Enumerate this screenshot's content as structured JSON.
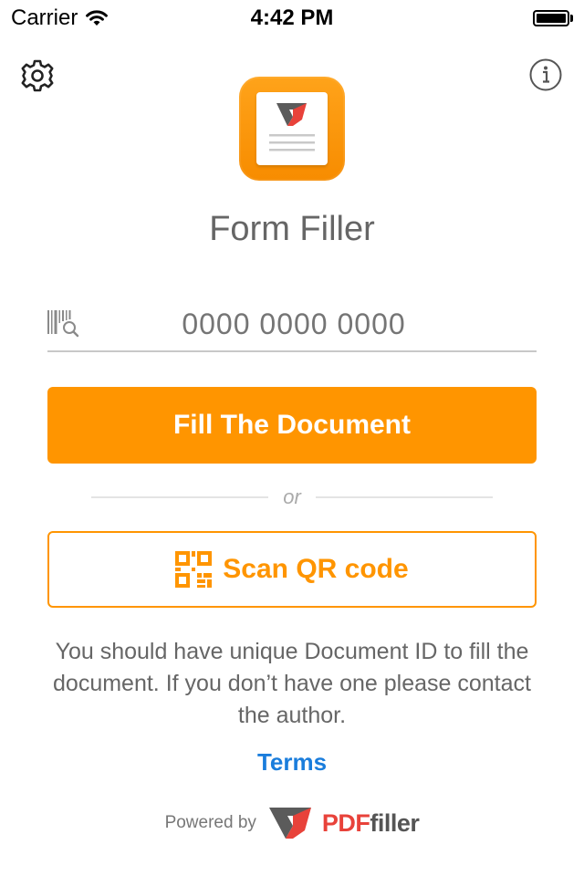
{
  "status_bar": {
    "carrier": "Carrier",
    "time": "4:42 PM",
    "wifi_icon": "wifi-icon",
    "battery_icon": "battery-icon"
  },
  "header": {
    "settings_icon": "gear-icon",
    "info_icon": "info-icon"
  },
  "app": {
    "title": "Form Filler",
    "icon": "form-filler-app-icon"
  },
  "document_id": {
    "placeholder": "0000 0000 0000",
    "value": "",
    "icon": "barcode-search-icon"
  },
  "fill_button": {
    "label": "Fill The Document"
  },
  "divider": {
    "label": "or"
  },
  "scan_button": {
    "label": "Scan QR code",
    "icon": "qr-code-icon"
  },
  "helper": {
    "text": "You should have unique Document ID to fill the document. If you don’t have one please contact the author."
  },
  "terms": {
    "label": "Terms"
  },
  "footer": {
    "powered_by": "Powered by",
    "brand_part1": "PDF",
    "brand_part2": "filler"
  },
  "colors": {
    "accent": "#ff9500",
    "link": "#1a7ddc",
    "brand_red": "#e8423a",
    "text_gray": "#666666"
  }
}
